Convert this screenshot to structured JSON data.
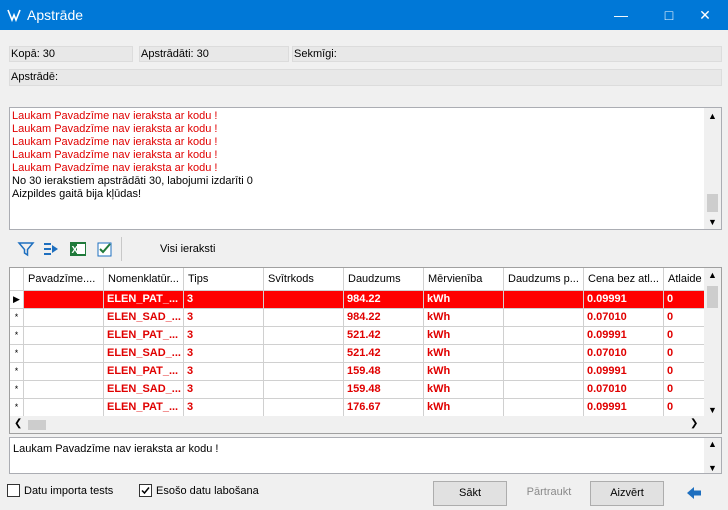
{
  "window": {
    "title": "Apstrāde",
    "min_icon": "minimize-icon",
    "max_icon": "maximize-icon",
    "close_icon": "close-icon"
  },
  "stats": {
    "kopa": "Kopā: 30",
    "apstradati": "Apstrādāti: 30",
    "sekmigi": "Sekmīgi:",
    "apstrade": "Apstrādē:"
  },
  "log": {
    "lines": [
      "Laukam Pavadzīme nav ieraksta ar kodu !",
      "Laukam Pavadzīme nav ieraksta ar kodu !",
      "Laukam Pavadzīme nav ieraksta ar kodu !",
      "Laukam Pavadzīme nav ieraksta ar kodu !",
      "Laukam Pavadzīme nav ieraksta ar kodu !",
      "No 30 ierakstiem apstrādāti 30, labojumi izdarīti 0",
      "Aizpildes gaitā bija kļūdas!"
    ],
    "colors": {
      "error": "#e00000",
      "info": "#000000"
    }
  },
  "toolbar": {
    "filter_label": "Visi ieraksti",
    "icons": [
      "filter-icon",
      "export-icon",
      "excel-icon",
      "checklist-icon"
    ]
  },
  "grid": {
    "columns": [
      "Pavadzīme....",
      "Nomenklatūr...",
      "Tips",
      "Svītrkods",
      "Daudzums",
      "Mērvienība",
      "Daudzums p...",
      "Cena bez atl...",
      "Atlaide"
    ],
    "rows": [
      [
        "",
        "ELEN_PAT_...",
        "3",
        "",
        "984.22",
        "kWh",
        "",
        "0.09991",
        "0"
      ],
      [
        "",
        "ELEN_SAD_...",
        "3",
        "",
        "984.22",
        "kWh",
        "",
        "0.07010",
        "0"
      ],
      [
        "",
        "ELEN_PAT_...",
        "3",
        "",
        "521.42",
        "kWh",
        "",
        "0.09991",
        "0"
      ],
      [
        "",
        "ELEN_SAD_...",
        "3",
        "",
        "521.42",
        "kWh",
        "",
        "0.07010",
        "0"
      ],
      [
        "",
        "ELEN_PAT_...",
        "3",
        "",
        "159.48",
        "kWh",
        "",
        "0.09991",
        "0"
      ],
      [
        "",
        "ELEN_SAD_...",
        "3",
        "",
        "159.48",
        "kWh",
        "",
        "0.07010",
        "0"
      ],
      [
        "",
        "ELEN_PAT_...",
        "3",
        "",
        "176.67",
        "kWh",
        "",
        "0.09991",
        "0"
      ]
    ],
    "row_markers": [
      "▶",
      "*",
      "*",
      "*",
      "*",
      "*",
      "*"
    ],
    "selected_row": 0,
    "selected_color": "#ff0000",
    "text_color": "#e00000"
  },
  "message": "Laukam Pavadzīme nav ieraksta ar kodu !",
  "footer": {
    "chk_import_tests": {
      "label": "Datu importa tests",
      "checked": false
    },
    "chk_existing_fix": {
      "label": "Esošo datu labošana",
      "checked": true
    },
    "btn_start": "Sākt",
    "btn_stop": "Pārtraukt",
    "btn_close": "Aizvērt",
    "back_icon": "back-arrow-icon"
  }
}
